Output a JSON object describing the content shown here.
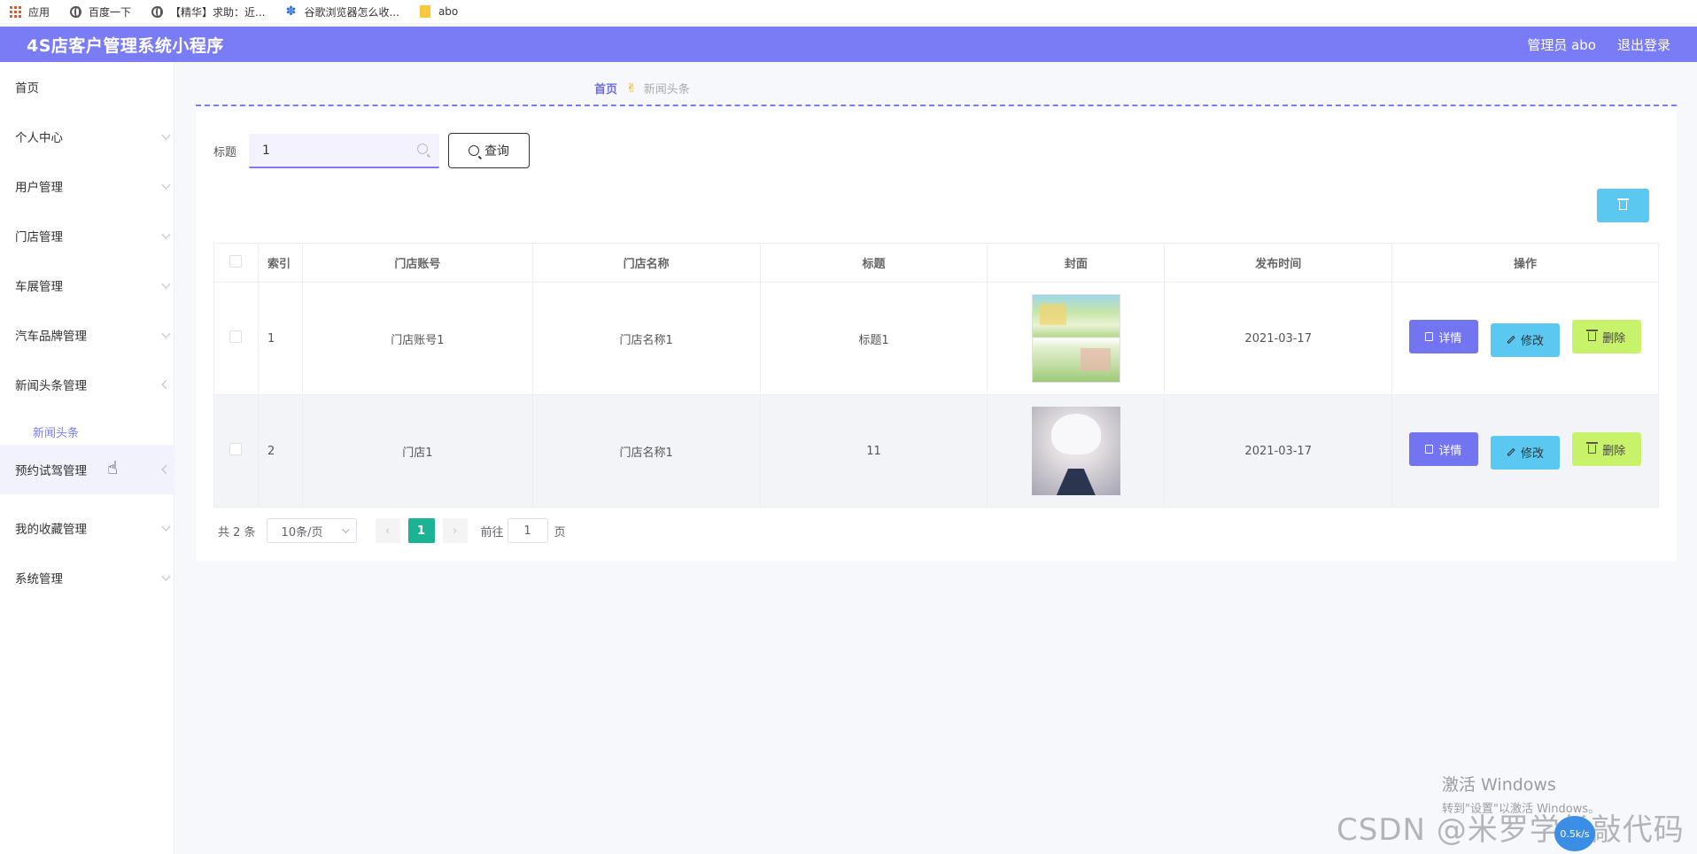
{
  "bookmarks": [
    {
      "label": "应用",
      "icon": "apps-grid-icon"
    },
    {
      "label": "百度一下",
      "icon": "globe-icon"
    },
    {
      "label": "【精华】求助：近...",
      "icon": "globe-icon"
    },
    {
      "label": "谷歌浏览器怎么收...",
      "icon": "baidu-paw-icon"
    },
    {
      "label": "abo",
      "icon": "folder-icon"
    }
  ],
  "header": {
    "title": "4S店客户管理系统小程序",
    "user_label": "管理员 abo",
    "logout_label": "退出登录",
    "accent_color": "#7a7cf6"
  },
  "sidebar": {
    "items": [
      {
        "label": "首页"
      },
      {
        "label": "个人中心"
      },
      {
        "label": "用户管理"
      },
      {
        "label": "门店管理"
      },
      {
        "label": "车展管理"
      },
      {
        "label": "汽车品牌管理"
      },
      {
        "label": "新闻头条管理"
      },
      {
        "label": "预约试驾管理"
      },
      {
        "label": "我的收藏管理"
      },
      {
        "label": "系统管理"
      }
    ],
    "active_sub_item": "新闻头条"
  },
  "breadcrumb": {
    "home": "首页",
    "current": "新闻头条"
  },
  "search": {
    "label": "标题",
    "value": "1",
    "button_label": "查询"
  },
  "table": {
    "columns": [
      "索引",
      "门店账号",
      "门店名称",
      "标题",
      "封面",
      "发布时间",
      "操作"
    ],
    "rows": [
      {
        "index": "1",
        "account": "门店账号1",
        "name": "门店名称1",
        "title": "标题1",
        "cover": "promo-poster-cover",
        "date": "2021-03-17"
      },
      {
        "index": "2",
        "account": "门店1",
        "name": "门店名称1",
        "title": "11",
        "cover": "anime-avatar-cover",
        "date": "2021-03-17"
      }
    ],
    "actions": {
      "detail": "详情",
      "edit": "修改",
      "delete": "删除"
    }
  },
  "pagination": {
    "total_label": "共 2 条",
    "page_size": "10条/页",
    "current_page": "1",
    "goto_prefix": "前往",
    "goto_value": "1",
    "goto_suffix": "页"
  },
  "watermark": {
    "activate_title": "激活 Windows",
    "activate_sub": "转到\"设置\"以激活 Windows。",
    "csdn": "CSDN @米罗学长敲代码",
    "float_label": "0.5k/s"
  }
}
